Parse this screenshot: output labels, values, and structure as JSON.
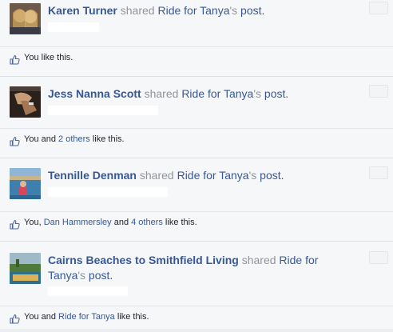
{
  "stories": [
    {
      "actor": "Karen Turner",
      "verb": " shared ",
      "page": "Ride for Tanya",
      "suffix_possessive": "'s",
      "suffix_post": " post.",
      "likes_prefix": "You like this.",
      "likes_mid": "",
      "likes_link": "",
      "likes_suffix": ""
    },
    {
      "actor": "Jess Nanna Scott",
      "verb": " shared ",
      "page": "Ride for Tanya",
      "suffix_possessive": "'s",
      "suffix_post": " post.",
      "likes_prefix": "You and ",
      "likes_link": "2 others",
      "likes_mid": "",
      "likes_suffix": " like this."
    },
    {
      "actor": "Tennille Denman",
      "verb": " shared ",
      "page": "Ride for Tanya",
      "suffix_possessive": "'s",
      "suffix_post": " post.",
      "likes_prefix": "You, ",
      "likes_link": "Dan Hammersley",
      "likes_mid": " and ",
      "likes_link2": "4 others",
      "likes_suffix": " like this."
    },
    {
      "actor": "Cairns Beaches to Smithfield Living",
      "verb": " shared ",
      "page": "Ride for",
      "page_line2": "Tanya",
      "suffix_possessive": "'s",
      "suffix_post": " post.",
      "likes_prefix": "You and ",
      "likes_link": "Ride for Tanya",
      "likes_mid": "",
      "likes_suffix": " like this."
    }
  ],
  "colors": {
    "link": "#365899",
    "muted": "#90949c",
    "bg": "#f6f7f9"
  },
  "icons": {
    "like": "thumbs-up-icon"
  }
}
